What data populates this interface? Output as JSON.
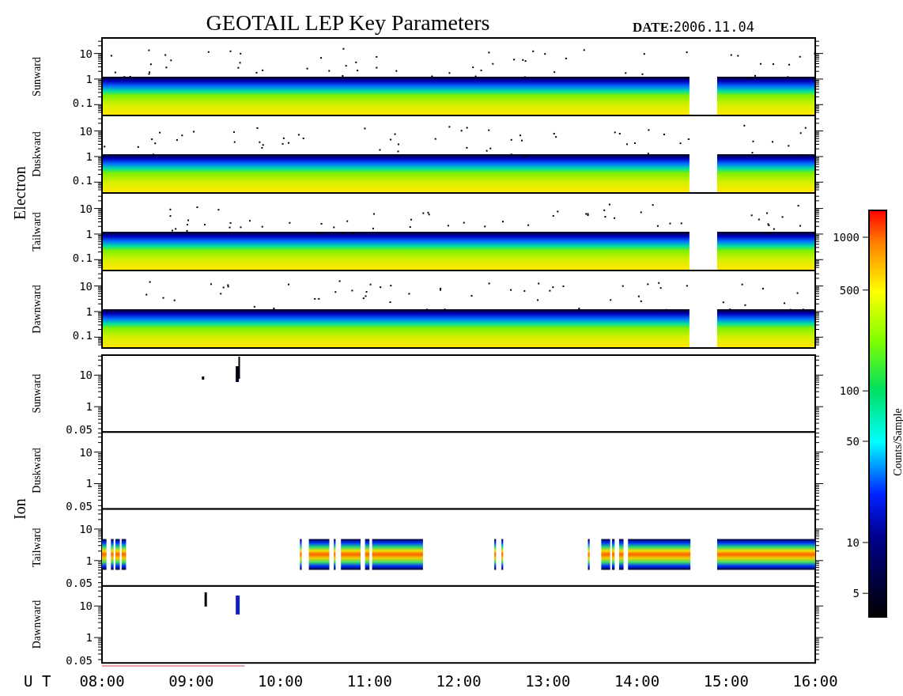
{
  "title": "GEOTAIL LEP Key Parameters",
  "date": {
    "label": "DATE:",
    "value": "2006.11.04"
  },
  "groups": [
    {
      "label": "Electron",
      "kind": "electron",
      "panels": [
        {
          "label": "Sunward",
          "yticks": [
            "10",
            "1",
            "0.1"
          ]
        },
        {
          "label": "Duskward",
          "yticks": [
            "10",
            "1",
            "0.1"
          ]
        },
        {
          "label": "Tailward",
          "yticks": [
            "10",
            "1",
            "0.1"
          ]
        },
        {
          "label": "Dawnward",
          "yticks": [
            "10",
            "1",
            "0.1"
          ]
        }
      ]
    },
    {
      "label": "Ion",
      "kind": "ion",
      "panels": [
        {
          "label": "Sunward",
          "yticks": [
            "10",
            "1",
            "0.05"
          ]
        },
        {
          "label": "Duskward",
          "yticks": [
            "10",
            "1",
            "0.05"
          ]
        },
        {
          "label": "Tailward",
          "yticks": [
            "10",
            "1",
            "0.05"
          ]
        },
        {
          "label": "Dawnward",
          "yticks": [
            "10",
            "1",
            "0.05"
          ]
        }
      ]
    }
  ],
  "x_axis": {
    "label": "U T",
    "ticks": [
      "08:00",
      "09:00",
      "10:00",
      "11:00",
      "12:00",
      "13:00",
      "14:00",
      "15:00",
      "16:00"
    ]
  },
  "color_scale": {
    "label": "Counts/Sample",
    "ticks": [
      "1000",
      "500",
      "100",
      "50",
      "10",
      "5"
    ]
  }
}
